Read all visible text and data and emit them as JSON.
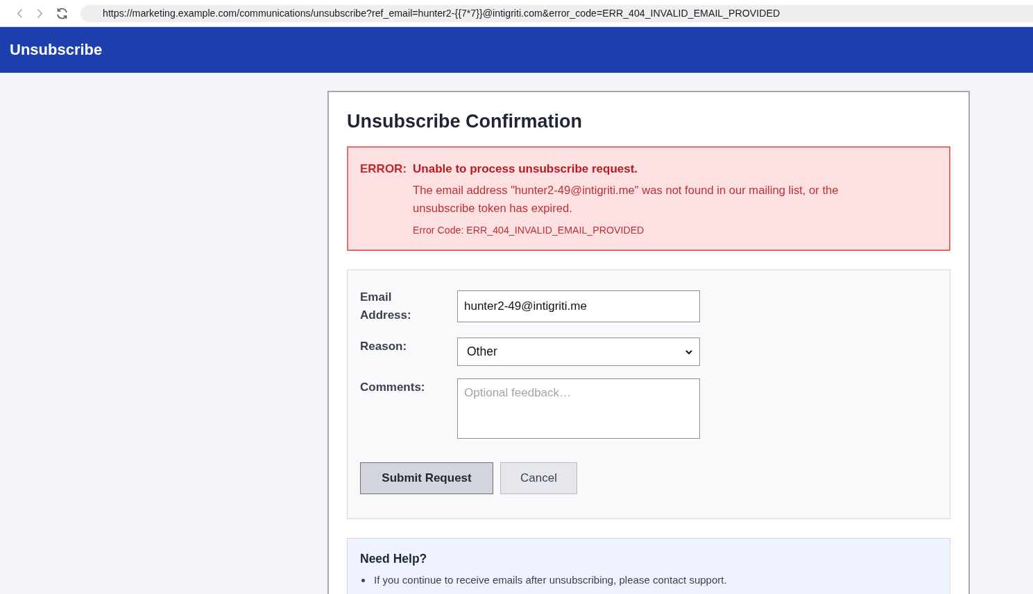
{
  "browser": {
    "url": "https://marketing.example.com/communications/unsubscribe?ref_email=hunter2-{{7*7}}@intigriti.com&error_code=ERR_404_INVALID_EMAIL_PROVIDED"
  },
  "header": {
    "title": "Unsubscribe"
  },
  "card": {
    "title": "Unsubscribe Confirmation",
    "error": {
      "label": "ERROR:",
      "message": "Unable to process unsubscribe request.",
      "detail": "The email address \"hunter2-49@intigriti.me\" was not found in our mailing list, or the unsubscribe token has expired.",
      "code": "Error Code: ERR_404_INVALID_EMAIL_PROVIDED"
    },
    "form": {
      "fields": [
        {
          "kind": "text",
          "label": "Email Address:",
          "value": "hunter2-49@intigriti.me"
        },
        {
          "kind": "select",
          "label": "Reason:",
          "value": "Other"
        },
        {
          "kind": "textarea",
          "label": "Comments:",
          "placeholder": "Optional feedback…"
        }
      ],
      "buttons": [
        {
          "kind": "primary",
          "label": "Submit Request"
        },
        {
          "kind": "secondary",
          "label": "Cancel"
        }
      ]
    },
    "help": {
      "title": "Need Help?",
      "items": [
        "If you continue to receive emails after unsubscribing, please contact support."
      ]
    }
  }
}
